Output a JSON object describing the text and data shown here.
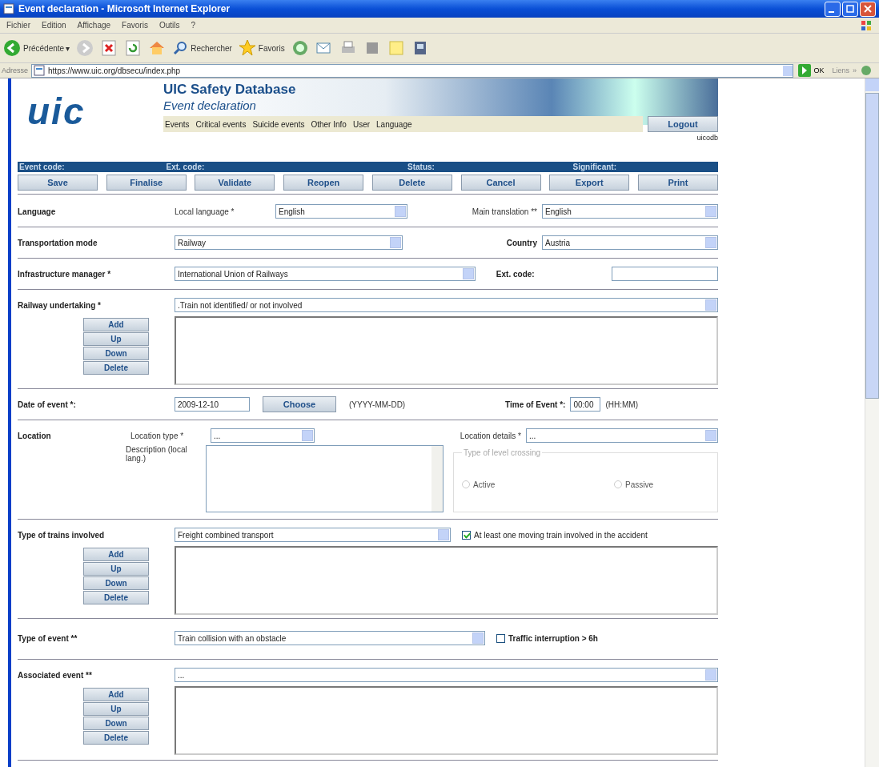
{
  "window": {
    "title": "Event declaration - Microsoft Internet Explorer"
  },
  "menu": [
    "Fichier",
    "Edition",
    "Affichage",
    "Favoris",
    "Outils",
    "?"
  ],
  "toolbar": {
    "back": "Précédente",
    "back_caret": "▾",
    "search": "Rechercher",
    "favorites": "Favoris"
  },
  "address": {
    "label": "Adresse",
    "url": "https://www.uic.org/dbsecu/index.php",
    "go": "OK",
    "links": "Liens",
    "more": "»"
  },
  "header": {
    "logo": "uic",
    "title": "UIC Safety Database",
    "subtitle": "Event declaration",
    "nav": [
      "Events",
      "Critical events",
      "Suicide events",
      "Other Info",
      "User",
      "Language"
    ],
    "logout": "Logout",
    "user": "uicodb"
  },
  "info_bar": [
    "Event code:",
    "Ext. code:",
    "Status:",
    "Significant:"
  ],
  "actions": [
    "Save",
    "Finalise",
    "Validate",
    "Reopen",
    "Delete",
    "Cancel",
    "Export",
    "Print"
  ],
  "form": {
    "language": {
      "label": "Language",
      "local_label": "Local language *",
      "local_value": "English",
      "main_label": "Main translation **",
      "main_value": "English"
    },
    "transport": {
      "label": "Transportation mode",
      "value": "Railway",
      "country_label": "Country",
      "country_value": "Austria"
    },
    "infra": {
      "label": "Infrastructure manager *",
      "value": "International Union of Railways",
      "ext_label": "Ext. code:"
    },
    "railway": {
      "label": "Railway undertaking *",
      "value": ".Train not identified/ or not involved",
      "buttons": [
        "Add",
        "Up",
        "Down",
        "Delete"
      ]
    },
    "date": {
      "label": "Date of event *:",
      "value": "2009-12-10",
      "choose": "Choose",
      "hint": "(YYYY-MM-DD)",
      "time_label": "Time of Event *:",
      "time_value": "00:00",
      "time_hint": "(HH:MM)"
    },
    "location": {
      "label": "Location",
      "type_label": "Location type *",
      "type_value": "...",
      "details_label": "Location details *",
      "details_value": "...",
      "desc_label": "Description (local lang.)",
      "crossing_legend": "Type of level crossing",
      "radios": [
        {
          "label": "Active",
          "selected": false
        },
        {
          "label": "Passive",
          "selected": false
        }
      ]
    },
    "trains": {
      "label": "Type of trains involved",
      "value": "Freight combined transport",
      "check_label": "At least one moving train involved in the accident",
      "checked": true,
      "buttons": [
        "Add",
        "Up",
        "Down",
        "Delete"
      ]
    },
    "event": {
      "label": "Type of event **",
      "value": "Train collision with an obstacle",
      "check_label": "Traffic interruption > 6h",
      "checked": false
    },
    "associated": {
      "label": "Associated event **",
      "value": "...",
      "buttons": [
        "Add",
        "Up",
        "Down",
        "Delete"
      ]
    }
  }
}
